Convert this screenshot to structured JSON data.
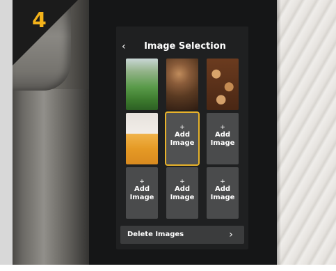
{
  "step_badge": {
    "number": "4",
    "color": "#f3b21a"
  },
  "screen": {
    "title": "Image Selection",
    "back_icon": "chevron-left-icon",
    "back_glyph": "‹",
    "tiles": [
      {
        "kind": "image",
        "image": "tea-plantation"
      },
      {
        "kind": "image",
        "image": "coffee-beans"
      },
      {
        "kind": "image",
        "image": "coffee-cups"
      },
      {
        "kind": "image",
        "image": "coffee-mug"
      },
      {
        "kind": "add",
        "plus": "+",
        "label_line1": "Add",
        "label_line2": "Image",
        "selected": true
      },
      {
        "kind": "add",
        "plus": "+",
        "label_line1": "Add",
        "label_line2": "Image"
      },
      {
        "kind": "add",
        "plus": "+",
        "label_line1": "Add",
        "label_line2": "Image"
      },
      {
        "kind": "add",
        "plus": "+",
        "label_line1": "Add",
        "label_line2": "Image"
      },
      {
        "kind": "add",
        "plus": "+",
        "label_line1": "Add",
        "label_line2": "Image"
      }
    ],
    "delete_row": {
      "label": "Delete Images",
      "chevron_glyph": "›",
      "icon": "chevron-right-icon"
    }
  },
  "colors": {
    "screen_bg": "#1f2021",
    "tile_bg": "#4a4b4c",
    "selection": "#e8b32b"
  }
}
